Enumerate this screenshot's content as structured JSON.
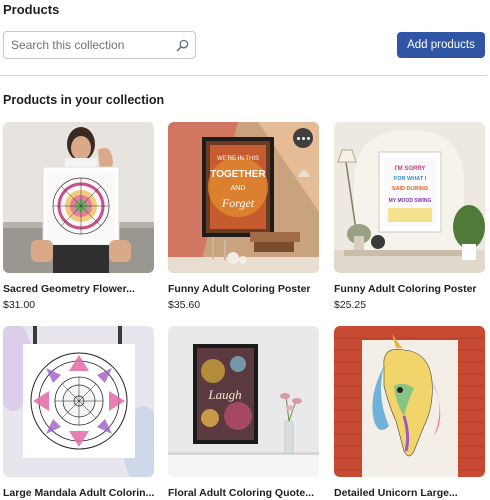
{
  "header": {
    "title": "Products",
    "search_placeholder": "Search this collection",
    "add_button": "Add products"
  },
  "collection": {
    "title": "Products in your collection",
    "products": [
      {
        "title": "Sacred Geometry Flower...",
        "price": "$31.00"
      },
      {
        "title": "Funny Adult Coloring Poster",
        "price": "$35.60",
        "poster_text": [
          "WE'RE IN THIS",
          "TOGETHER",
          "AND",
          "Forget"
        ]
      },
      {
        "title": "Funny Adult Coloring Poster",
        "price": "$25.25",
        "poster_text": [
          "I'M SORRY",
          "FOR WHAT I",
          "SAID DURING",
          "MY MOOD SWING"
        ]
      },
      {
        "title": "Large Mandala Adult Colorin...",
        "price": ""
      },
      {
        "title": "Floral Adult Coloring Quote...",
        "price": "",
        "poster_text": [
          "Laugh"
        ]
      },
      {
        "title": "Detailed Unicorn Large...",
        "price": ""
      }
    ]
  }
}
